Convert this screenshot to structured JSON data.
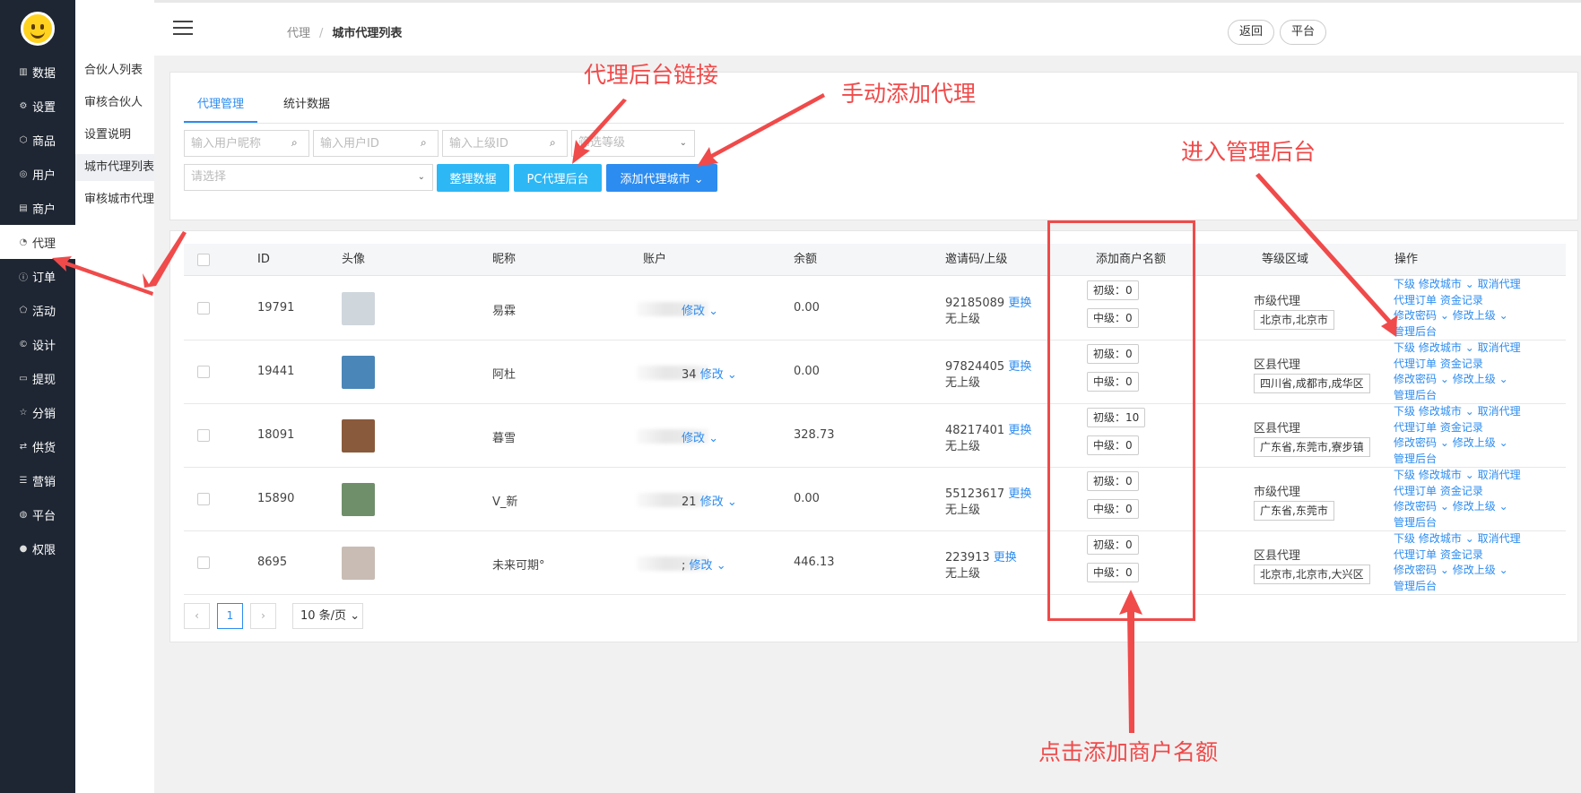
{
  "sidebar": {
    "items": [
      {
        "icon": "bar-chart-icon",
        "label": "数据"
      },
      {
        "icon": "gear-icon",
        "label": "设置"
      },
      {
        "icon": "cube-icon",
        "label": "商品"
      },
      {
        "icon": "user-icon",
        "label": "用户"
      },
      {
        "icon": "list-icon",
        "label": "商户"
      },
      {
        "icon": "pie-chart-icon",
        "label": "代理"
      },
      {
        "icon": "info-icon",
        "label": "订单"
      },
      {
        "icon": "tag-icon",
        "label": "活动"
      },
      {
        "icon": "copyright-icon",
        "label": "设计"
      },
      {
        "icon": "card-icon",
        "label": "提现"
      },
      {
        "icon": "star-icon",
        "label": "分销"
      },
      {
        "icon": "exchange-icon",
        "label": "供货"
      },
      {
        "icon": "menu-icon",
        "label": "营销"
      },
      {
        "icon": "basketball-icon",
        "label": "平台"
      },
      {
        "icon": "check-circle-icon",
        "label": "权限"
      }
    ]
  },
  "subnav": {
    "items": [
      "合伙人列表",
      "审核合伙人",
      "设置说明",
      "城市代理列表",
      "审核城市代理"
    ]
  },
  "header": {
    "breadcrumb_1": "代理",
    "breadcrumb_sep": "/",
    "breadcrumb_2": "城市代理列表",
    "back_label": "返回",
    "platform_label": "平台"
  },
  "tabs": [
    "代理管理",
    "统计数据"
  ],
  "filters": {
    "nickname_placeholder": "输入用户昵称",
    "userid_placeholder": "输入用户ID",
    "parentid_placeholder": "输入上级ID",
    "level_placeholder": "筛选等级",
    "region_placeholder": "请选择"
  },
  "buttons": {
    "tidy": "整理数据",
    "pc_admin": "PC代理后台",
    "add_city": "添加代理城市"
  },
  "table": {
    "headers": [
      "ID",
      "头像",
      "昵称",
      "账户",
      "余额",
      "邀请码/上级",
      "添加商户名额",
      "等级区域",
      "操作"
    ],
    "rows": [
      {
        "id": "19791",
        "nickname": "易霖",
        "account_suffix": "",
        "balance": "0.00",
        "invite": "92185089",
        "parent": "无上级",
        "q_primary": "初级：0",
        "q_middle": "中级：0",
        "level": "市级代理",
        "region": "北京市,北京市",
        "avatar_color": "#cfd6dc"
      },
      {
        "id": "19441",
        "nickname": "阿杜",
        "account_suffix": "34",
        "balance": "0.00",
        "invite": "97824405",
        "parent": "无上级",
        "q_primary": "初级：0",
        "q_middle": "中级：0",
        "level": "区县代理",
        "region": "四川省,成都市,成华区",
        "avatar_color": "#4a86b8"
      },
      {
        "id": "18091",
        "nickname": "暮雪",
        "account_suffix": "",
        "balance": "328.73",
        "invite": "48217401",
        "parent": "无上级",
        "q_primary": "初级：10",
        "q_middle": "中级：0",
        "level": "区县代理",
        "region": "广东省,东莞市,寮步镇",
        "avatar_color": "#8a5a3c"
      },
      {
        "id": "15890",
        "nickname": "V_新",
        "account_suffix": "21",
        "balance": "0.00",
        "invite": "55123617",
        "parent": "无上级",
        "q_primary": "初级：0",
        "q_middle": "中级：0",
        "level": "市级代理",
        "region": "广东省,东莞市",
        "avatar_color": "#6f8f6a"
      },
      {
        "id": "8695",
        "nickname": "未来可期°",
        "account_suffix": ";",
        "balance": "446.13",
        "invite": "223913",
        "parent": "无上级",
        "q_primary": "初级：0",
        "q_middle": "中级：0",
        "level": "区县代理",
        "region": "北京市,北京市,大兴区",
        "avatar_color": "#c8bcb4"
      }
    ],
    "modify_label": "修改",
    "replace_label": "更换",
    "ops": {
      "sub": "下级",
      "modify_city": "修改城市",
      "cancel_agent": "取消代理",
      "agent_orders": "代理订单",
      "fund_records": "资金记录",
      "modify_password": "修改密码",
      "modify_parent": "修改上级",
      "admin_backend": "管理后台"
    }
  },
  "pagination": {
    "prev": "‹",
    "current": "1",
    "next": "›",
    "page_size": "10 条/页"
  },
  "annotations": {
    "backend_link": "代理后台链接",
    "manual_add": "手动添加代理",
    "enter_admin": "进入管理后台",
    "click_quota": "点击添加商户名额"
  },
  "colors": {
    "sidebar_bg": "#1e2633",
    "primary": "#2d8cf0",
    "cyan_button": "#2db7f5",
    "annotation_red": "#f04a4a"
  }
}
